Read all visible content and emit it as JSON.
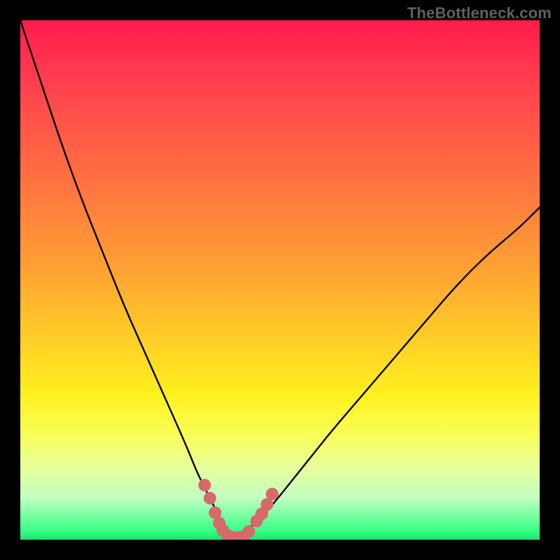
{
  "watermark": "TheBottleneck.com",
  "chart_data": {
    "type": "line",
    "title": "",
    "xlabel": "",
    "ylabel": "",
    "xlim": [
      0,
      100
    ],
    "ylim": [
      0,
      100
    ],
    "grid": false,
    "legend": false,
    "series": [
      {
        "name": "curve-left",
        "x": [
          0,
          4,
          8,
          12,
          16,
          20,
          24,
          28,
          32,
          34,
          36,
          38,
          39,
          40,
          41
        ],
        "values": [
          100,
          88,
          76,
          65,
          55,
          45,
          36,
          27,
          18,
          13,
          9,
          5,
          3,
          1,
          0
        ]
      },
      {
        "name": "curve-right",
        "x": [
          41,
          44,
          48,
          52,
          56,
          60,
          66,
          72,
          78,
          84,
          90,
          96,
          100
        ],
        "values": [
          0,
          2,
          6,
          11,
          16,
          21,
          28,
          35,
          42,
          49,
          55,
          60,
          64
        ]
      }
    ],
    "markers": {
      "name": "datapoints",
      "color": "#d66a6a",
      "points": [
        {
          "x": 35.5,
          "y": 10.5
        },
        {
          "x": 36.5,
          "y": 8.0
        },
        {
          "x": 37.5,
          "y": 5.2
        },
        {
          "x": 38.3,
          "y": 3.2
        },
        {
          "x": 39.0,
          "y": 1.8
        },
        {
          "x": 40.0,
          "y": 0.8
        },
        {
          "x": 41.0,
          "y": 0.4
        },
        {
          "x": 42.0,
          "y": 0.4
        },
        {
          "x": 43.0,
          "y": 0.6
        },
        {
          "x": 44.0,
          "y": 1.6
        },
        {
          "x": 45.5,
          "y": 3.6
        },
        {
          "x": 46.5,
          "y": 5.0
        },
        {
          "x": 47.5,
          "y": 6.8
        },
        {
          "x": 48.5,
          "y": 8.8
        }
      ]
    }
  }
}
